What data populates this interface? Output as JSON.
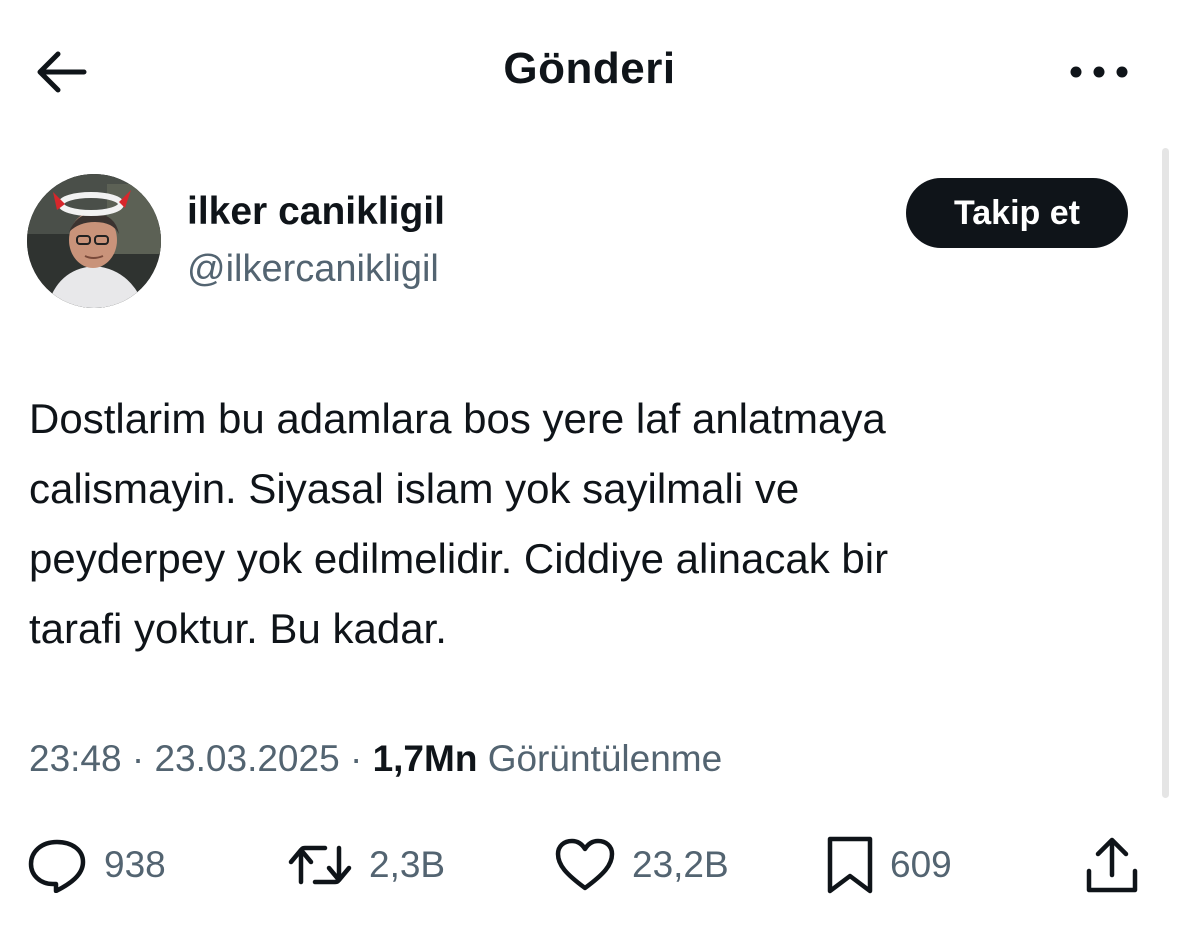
{
  "header": {
    "title": "Gönderi",
    "back_icon": "arrow-left-icon",
    "more_icon": "more-horizontal-icon"
  },
  "author": {
    "name": "ilker canikligil",
    "handle": "@ilkercanikligil",
    "follow_label": "Takip et"
  },
  "tweet": {
    "lines": [
      "Dostlarim bu adamlara bos yere laf anlatmaya",
      "calismayin. Siyasal islam yok sayilmali ve",
      "peyderpey yok edilmelidir. Ciddiye alinacak bir",
      "tarafi yoktur. Bu kadar."
    ]
  },
  "meta": {
    "time": "23:48",
    "separator": " · ",
    "date": "23.03.2025",
    "views_count": "1,7Mn",
    "views_label": "Görüntülenme"
  },
  "actions": {
    "reply_count": "938",
    "repost_count": "2,3B",
    "like_count": "23,2B",
    "bookmark_count": "609"
  },
  "colors": {
    "text_primary": "#0f1419",
    "text_secondary": "#536471",
    "follow_bg": "#0f1419",
    "follow_text": "#ffffff"
  }
}
